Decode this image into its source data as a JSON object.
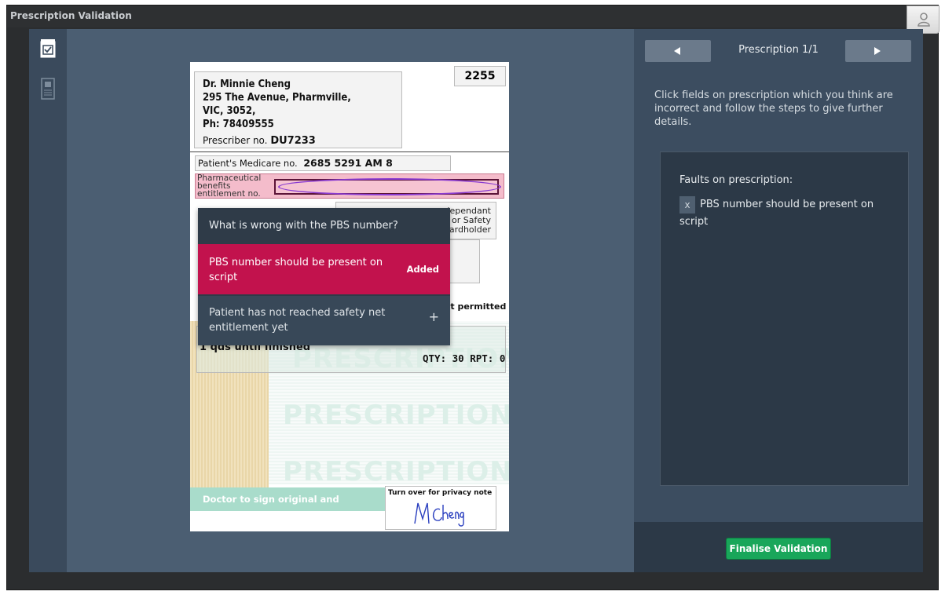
{
  "window": {
    "title": "Prescription Validation"
  },
  "prescription": {
    "doctor_name": "Dr. Minnie Cheng",
    "address_line1": "295 The Avenue, Pharmville,",
    "address_line2": "VIC, 3052,",
    "phone": "Ph: 78409555",
    "prescriber_label": "Prescriber no.",
    "prescriber_no": "DU7233",
    "script_number": "2255",
    "medicare_label": "Patient's Medicare no.",
    "medicare_no": "2685 5291 AM 8",
    "pbs_label_1": "Pharmaceutical",
    "pbs_label_2": "benefits",
    "pbs_label_3": "entitlement no.",
    "dependant_1": "dependant",
    "dependant_2": "y or Safety",
    "dependant_3": "ardholder",
    "not_permitted": "not permitted",
    "dose": "1 qds until finished",
    "qty": "QTY: 30 RPT: 0",
    "watermark": "PRESCRIPTION",
    "sign_note": "Doctor to sign original and duplicate",
    "turn_over": "Turn over for privacy note",
    "signature": "MCheng"
  },
  "dropdown": {
    "question": "What is wrong with the PBS number?",
    "option1": "PBS number should be present on script",
    "option1_status": "Added",
    "option2": "Patient has not reached safety net entitlement yet",
    "option2_action": "+"
  },
  "panel": {
    "counter": "Prescription 1/1",
    "instructions": "Click fields on prescription which you think are incorrect and follow the steps to give further details.",
    "faults_title": "Faults on prescription:",
    "fault_remove": "x",
    "fault1": "PBS number should be present on script",
    "finalise_label": "Finalise Validation"
  },
  "icons": {
    "user": "user-icon",
    "checklist": "checklist-icon",
    "document": "document-icon",
    "prev": "arrow-left-icon",
    "next": "arrow-right-icon"
  }
}
